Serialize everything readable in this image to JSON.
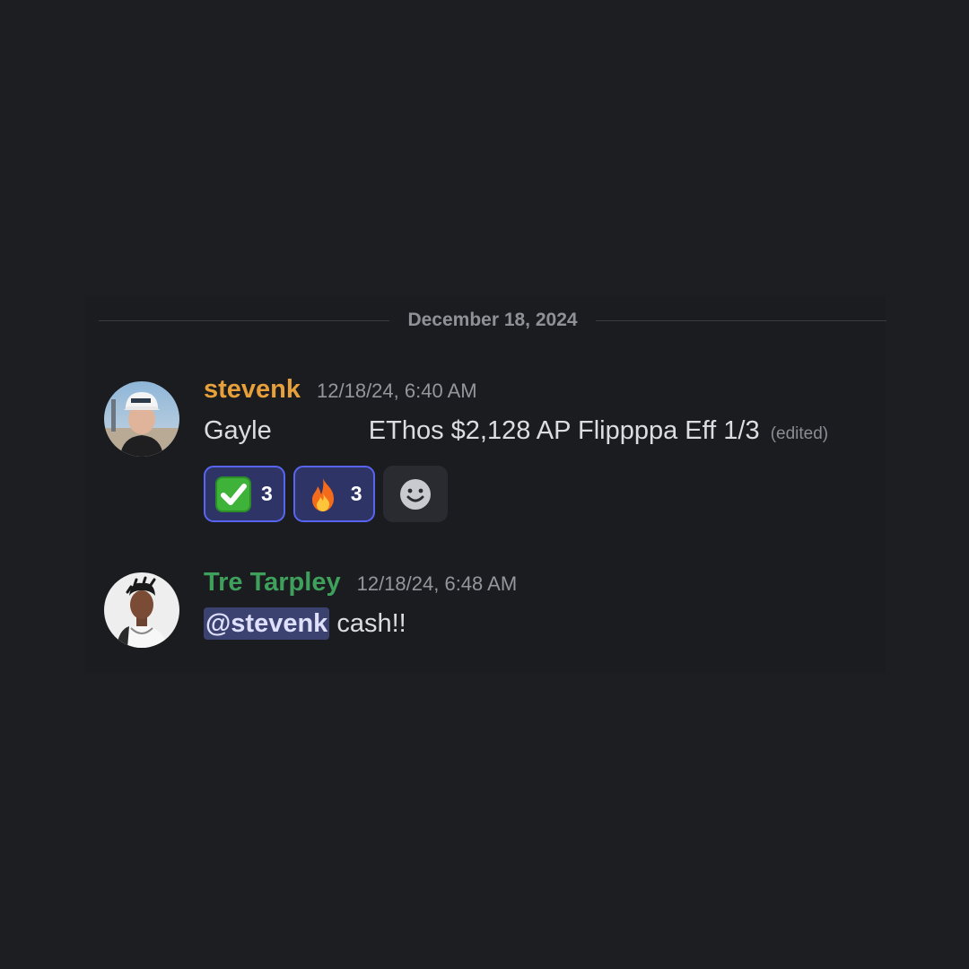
{
  "date_divider": "December 18, 2024",
  "messages": [
    {
      "username": "stevenk",
      "username_color": "#e8a13a",
      "timestamp": "12/18/24, 6:40 AM",
      "text_part1": "Gayle",
      "text_part2": "EThos $2,128 AP Flippppa Eff 1/3",
      "edited": "(edited)",
      "reactions": [
        {
          "icon": "check-mark-button-icon",
          "count": "3"
        },
        {
          "icon": "fire-icon",
          "count": "3"
        }
      ]
    },
    {
      "username": "Tre Tarpley",
      "username_color": "#3fa05c",
      "timestamp": "12/18/24, 6:48 AM",
      "mention": "@stevenk",
      "text": "cash!!"
    }
  ],
  "colors": {
    "background": "#1d1e22",
    "accent": "#5865f2",
    "reaction_bg": "#2e3566"
  }
}
